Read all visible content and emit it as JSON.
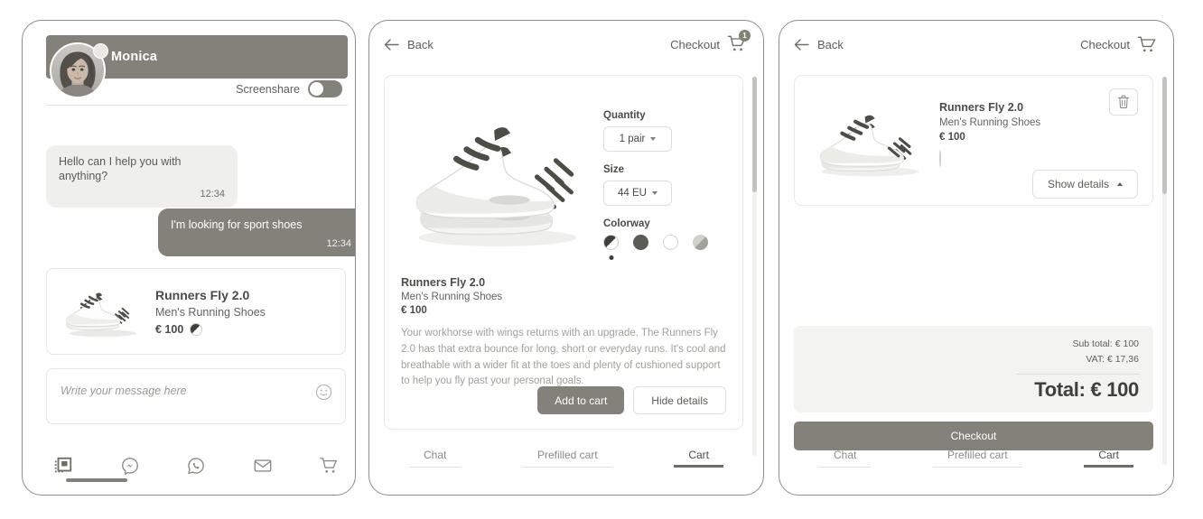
{
  "chat": {
    "contact_name": "Monica",
    "screenshare_label": "Screenshare",
    "messages": [
      {
        "text": "Hello can I help you with anything?",
        "time": "12:34",
        "direction": "in"
      },
      {
        "text": "I'm looking for sport shoes",
        "time": "12:34",
        "direction": "out"
      }
    ],
    "product_card": {
      "title": "Runners Fly 2.0",
      "subtitle": "Men's Running Shoes",
      "price": "€ 100"
    },
    "composer_placeholder": "Write your message here",
    "channels": [
      {
        "name": "widget-icon"
      },
      {
        "name": "messenger-icon"
      },
      {
        "name": "whatsapp-icon"
      },
      {
        "name": "email-icon"
      },
      {
        "name": "cart-icon"
      }
    ]
  },
  "detail": {
    "back_label": "Back",
    "checkout_label": "Checkout",
    "cart_count": "1",
    "quantity_label": "Quantity",
    "quantity_value": "1 pair",
    "size_label": "Size",
    "size_value": "44 EU",
    "colorway_label": "Colorway",
    "colorways": [
      "split-black-white",
      "dark-grey",
      "white",
      "grey-gradient"
    ],
    "selected_colorway_index": 0,
    "title": "Runners Fly 2.0",
    "subtitle": "Men's Running Shoes",
    "price": "€ 100",
    "description": "Your workhorse with wings returns with an upgrade. The Runners Fly 2.0 has that extra bounce for long, short or everyday runs. It's cool and breathable with a wider fit at the toes and plenty of cushioned support to help you fly past your personal goals.",
    "add_to_cart_label": "Add to cart",
    "hide_details_label": "Hide details",
    "tabs": [
      {
        "label": "Chat",
        "active": false
      },
      {
        "label": "Prefilled cart",
        "active": false
      },
      {
        "label": "Cart",
        "active": true
      }
    ]
  },
  "cart": {
    "back_label": "Back",
    "checkout_label": "Checkout",
    "item": {
      "title": "Runners Fly 2.0",
      "subtitle": "Men's Running Shoes",
      "price": "€ 100",
      "colorway": "split-black-white"
    },
    "delete_icon": "trash-icon",
    "show_details_label": "Show details",
    "sub_total": "Sub total: € 100",
    "vat": "VAT: € 17,36",
    "total": "Total: € 100",
    "checkout_button_label": "Checkout",
    "tabs": [
      {
        "label": "Chat",
        "active": false
      },
      {
        "label": "Prefilled cart",
        "active": false
      },
      {
        "label": "Cart",
        "active": true
      }
    ]
  },
  "colors": {
    "brand": "#83827a",
    "bubble_in": "#efefed",
    "text_dark": "#4b4b48",
    "text_muted": "#8b8b87",
    "panel_grey": "#f3f3f1"
  }
}
